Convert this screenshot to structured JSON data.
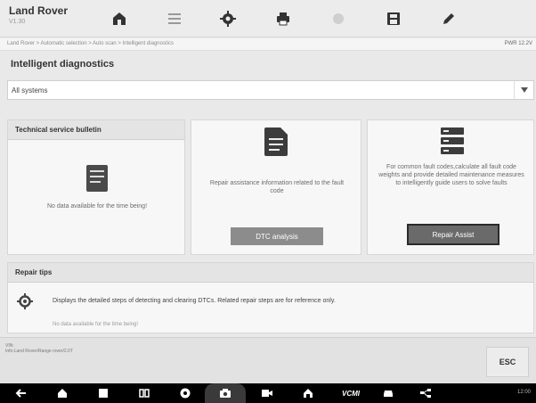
{
  "header": {
    "title": "Land Rover",
    "subtitle": "V1.30",
    "tools": [
      "home-icon",
      "vehicle-swap-icon",
      "settings-icon",
      "print-icon",
      "help-icon",
      "save-icon",
      "edit-icon"
    ]
  },
  "breadcrumb": {
    "path": "Land Rover > Automatic selection > Auto scan > Intelligent diagnostics",
    "status": "PWR 12.2V"
  },
  "page": {
    "title": "Intelligent diagnostics"
  },
  "system_select": {
    "value": "All systems"
  },
  "cards": {
    "tsb": {
      "title": "Technical service bulletin",
      "empty_text": "No data available for the time being!"
    },
    "dtc": {
      "description": "Repair assistance information related to the fault code",
      "button": "DTC analysis"
    },
    "repair": {
      "description": "For common fault codes,calculate all fault code weights and provide detailed maintenance measures to intelligently guide users to solve faults",
      "button": "Repair Assist"
    }
  },
  "repair_tips": {
    "title": "Repair tips",
    "description": "Displays the detailed steps of detecting and clearing DTCs. Related repair steps are for reference only.",
    "empty_text": "No data available for the time being!"
  },
  "footer": {
    "info_line1": "VIN:",
    "info_line2": "Info:Land Rover/Range rover/2.0T",
    "esc_label": "ESC"
  },
  "navbar": {
    "icons": [
      "back-icon",
      "home-nav-icon",
      "recent-apps-icon",
      "multitask-icon",
      "browser-icon",
      "camera-icon",
      "screen-record-icon",
      "vehicle-home-icon",
      "vci-icon",
      "car-icon",
      "network-icon"
    ],
    "vci_label": "VCMI",
    "status": "12:00"
  },
  "colors": {
    "button_gray": "#8c8c8c",
    "button_dark": "#6a6a6a",
    "accent_border": "#2a2a2a"
  }
}
